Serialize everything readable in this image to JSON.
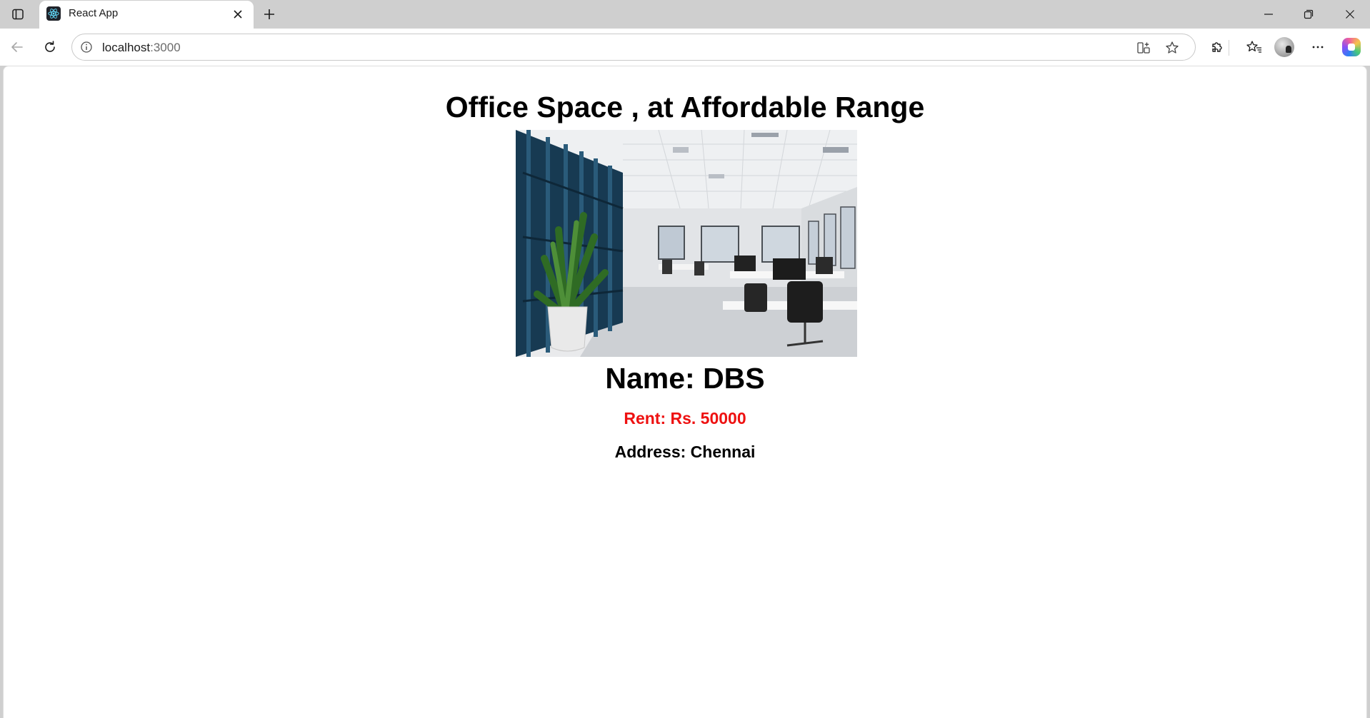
{
  "browser": {
    "tab_title": "React App",
    "url_host": "localhost",
    "url_port": ":3000",
    "icons": {
      "tab_actions": "tab-actions-icon",
      "tab_favicon": "react-logo-icon",
      "tab_close": "close-icon",
      "new_tab": "plus-icon",
      "minimize": "minimize-icon",
      "restore": "restore-icon",
      "close_window": "close-icon",
      "back": "back-arrow-icon",
      "reload": "reload-icon",
      "site_info": "info-icon",
      "split_screen": "split-screen-icon",
      "add_favorite": "star-icon",
      "extensions": "puzzle-icon",
      "favorites": "favorites-icon",
      "profile": "avatar",
      "more": "more-icon",
      "copilot": "copilot-icon"
    }
  },
  "page": {
    "title": "Office Space , at Affordable Range",
    "image_description_icon": "office-photo",
    "name_line": "Name: DBS",
    "rent_line": "Rent: Rs. 50000",
    "rent_color": "#ee1111",
    "address_line": "Address: Chennai"
  }
}
